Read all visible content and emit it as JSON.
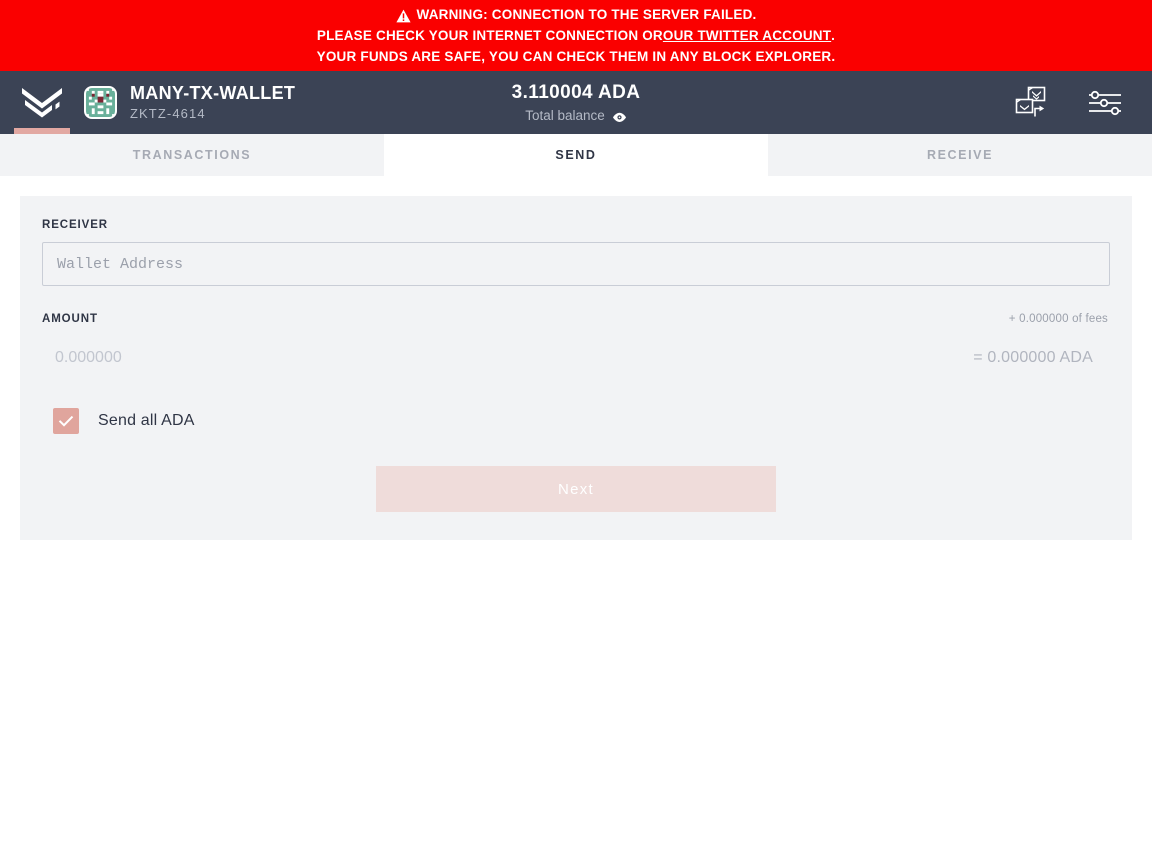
{
  "warning": {
    "icon": "warning-triangle-icon",
    "line1": "WARNING: CONNECTION TO THE SERVER FAILED.",
    "line2_before": "PLEASE CHECK YOUR INTERNET CONNECTION OR ",
    "line2_link": "OUR TWITTER ACCOUNT",
    "line2_after": ".",
    "line3": "YOUR FUNDS ARE SAFE, YOU CAN CHECK THEM IN ANY BLOCK EXPLORER.",
    "background_color": "#fa0000",
    "text_color": "#ffffff"
  },
  "header": {
    "logo_icon": "daedalus-logo-icon",
    "wallet_avatar_icon": "wallet-identicon-avatar",
    "wallet_name": "MANY-TX-WALLET",
    "wallet_id": "ZKTZ-4614",
    "balance_amount": "3.110004 ADA",
    "balance_label": "Total balance",
    "balance_toggle_icon": "eye-icon",
    "wallet_switch_icon": "wallet-switch-icon",
    "settings_icon": "sliders-settings-icon",
    "background_color": "#3b4355",
    "accent_color": "#e2a8a2"
  },
  "tabs": [
    {
      "id": "transactions",
      "label": "Transactions",
      "active": false
    },
    {
      "id": "send",
      "label": "Send",
      "active": true
    },
    {
      "id": "receive",
      "label": "Receive",
      "active": false
    }
  ],
  "send_form": {
    "receiver_label": "Receiver",
    "receiver_value": "",
    "receiver_placeholder": "Wallet Address",
    "amount_label": "Amount",
    "amount_value": "",
    "amount_placeholder": "0.000000",
    "fees_note": "+ 0.000000 of fees",
    "total_note": "= 0.000000 ADA",
    "send_all_label": "Send all ADA",
    "send_all_checked": true,
    "checkbox_color": "#e0a59d",
    "next_label": "Next",
    "next_disabled": true,
    "next_color": "#efdcda",
    "card_background": "#f2f3f5"
  }
}
